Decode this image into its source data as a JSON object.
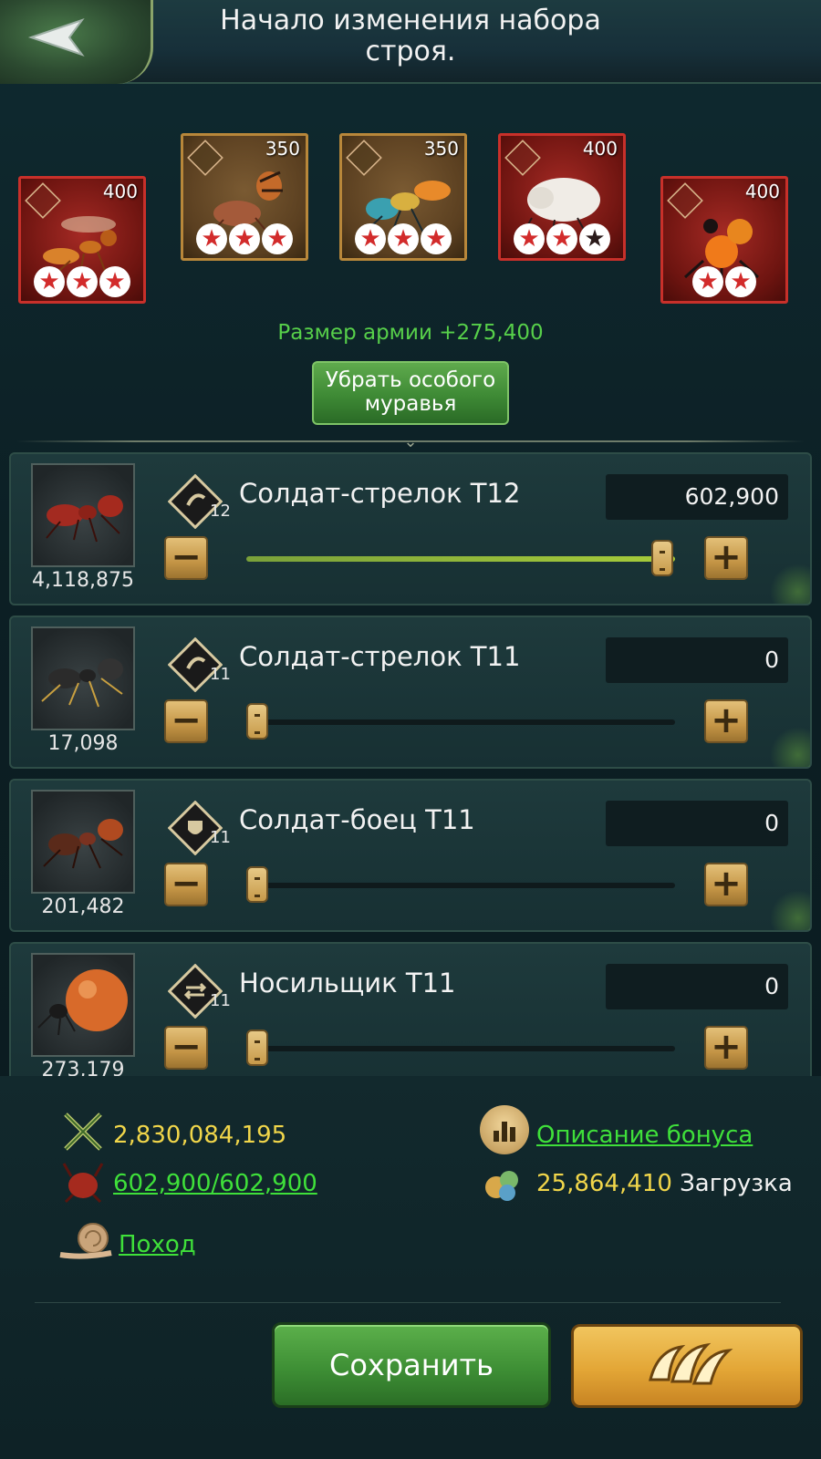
{
  "header": {
    "title": "Начало изменения набора строя."
  },
  "heroes": [
    {
      "cost": "400",
      "stars": 3,
      "filled": 3,
      "frame": "red"
    },
    {
      "cost": "350",
      "stars": 3,
      "filled": 3,
      "frame": "bronze"
    },
    {
      "cost": "350",
      "stars": 3,
      "filled": 3,
      "frame": "bronze"
    },
    {
      "cost": "400",
      "stars": 3,
      "filled": 2,
      "frame": "red"
    },
    {
      "cost": "400",
      "stars": 2,
      "filled": 2,
      "frame": "red"
    }
  ],
  "army_size_label": "Размер армии +275,400",
  "remove_special_label": "Убрать особого муравья",
  "troops": [
    {
      "name": "Солдат-стрелок T12",
      "tier": "12",
      "owned": "4,118,875",
      "selected": "602,900",
      "fill": 1.0,
      "role_icon": "shooter-icon"
    },
    {
      "name": "Солдат-стрелок T11",
      "tier": "11",
      "owned": "17,098",
      "selected": "0",
      "fill": 0.0,
      "role_icon": "shooter-icon"
    },
    {
      "name": "Солдат-боец T11",
      "tier": "11",
      "owned": "201,482",
      "selected": "0",
      "fill": 0.0,
      "role_icon": "shield-icon"
    },
    {
      "name": "Носильщик T11",
      "tier": "11",
      "owned": "273,179",
      "selected": "0",
      "fill": 0.0,
      "role_icon": "carrier-icon"
    }
  ],
  "stats": {
    "power": "2,830,084,195",
    "capacity": "602,900/602,900",
    "march": "Поход",
    "bonus_link": "Описание бонуса",
    "load_value": "25,864,410",
    "load_label": "Загрузка"
  },
  "buttons": {
    "save": "Сохранить"
  },
  "colors": {
    "accent_green": "#3fe03a",
    "gold_text": "#f1d64a",
    "army_green": "#57d04a"
  }
}
